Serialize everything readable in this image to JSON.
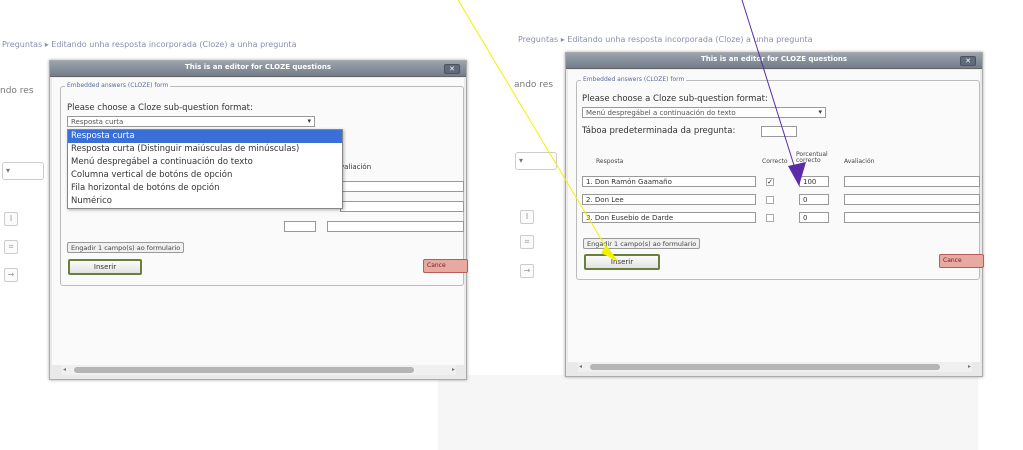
{
  "breadcrumb_left": {
    "link": "Preguntas",
    "sep": "▸",
    "current": "Editando unha resposta incorporada (Cloze) a unha pregunta"
  },
  "breadcrumb_right": {
    "link": "Preguntas",
    "sep": "▸",
    "current": "Editando unha resposta incorporada (Cloze) a unha pregunta"
  },
  "bg_left_label": "ndo res",
  "bg_right_label": "ando res",
  "left_dialog": {
    "title": "This is an editor for CLOZE questions",
    "close": "✕",
    "legend": "Embedded answers (CLOZE) form",
    "prompt": "Please choose a Cloze sub-question format:",
    "selected": "Resposta curta",
    "options": [
      "Resposta curta",
      "Resposta curta (Distinguir maiúsculas de minúsculas)",
      "Menú despregábel a continuación do texto",
      "Columna vertical de botóns de opción",
      "Fila horizontal de botóns de opción",
      "Numérico"
    ],
    "col_fragment": "valiación",
    "add_button": "Engadir 1 campo(s) ao formulario",
    "insert_button": "Inserir",
    "cancel_button": "Cance"
  },
  "right_dialog": {
    "title": "This is an editor for CLOZE questions",
    "close": "✕",
    "legend": "Embedded answers (CLOZE) form",
    "prompt": "Please choose a Cloze sub-question format:",
    "selected": "Menú despregábel a continuación do texto",
    "default_grade_label": "Táboa predeterminada da pregunta:",
    "headers": {
      "answer": "Resposta",
      "correct": "Correcto",
      "grade": "Porcentual\ncorrecto",
      "feedback": "Avaliación"
    },
    "rows": [
      {
        "num": "1.",
        "answer": "Don Ramón Gaamaño",
        "correct": "✓",
        "grade": "100",
        "feedback": ""
      },
      {
        "num": "2.",
        "answer": "Don Lee",
        "correct": "",
        "grade": "0",
        "feedback": ""
      },
      {
        "num": "3.",
        "answer": "Don Eusebio de Darde",
        "correct": "",
        "grade": "0",
        "feedback": ""
      }
    ],
    "add_button": "Engadir 1 campo(s) ao formulario",
    "insert_button": "Inserir",
    "cancel_button": "Cance"
  },
  "colors": {
    "annotation_yellow": "#f2f200",
    "annotation_purple": "#5b2ca8",
    "dropdown_highlight": "#3b6fd8",
    "insert_border": "#6a7f3a"
  }
}
